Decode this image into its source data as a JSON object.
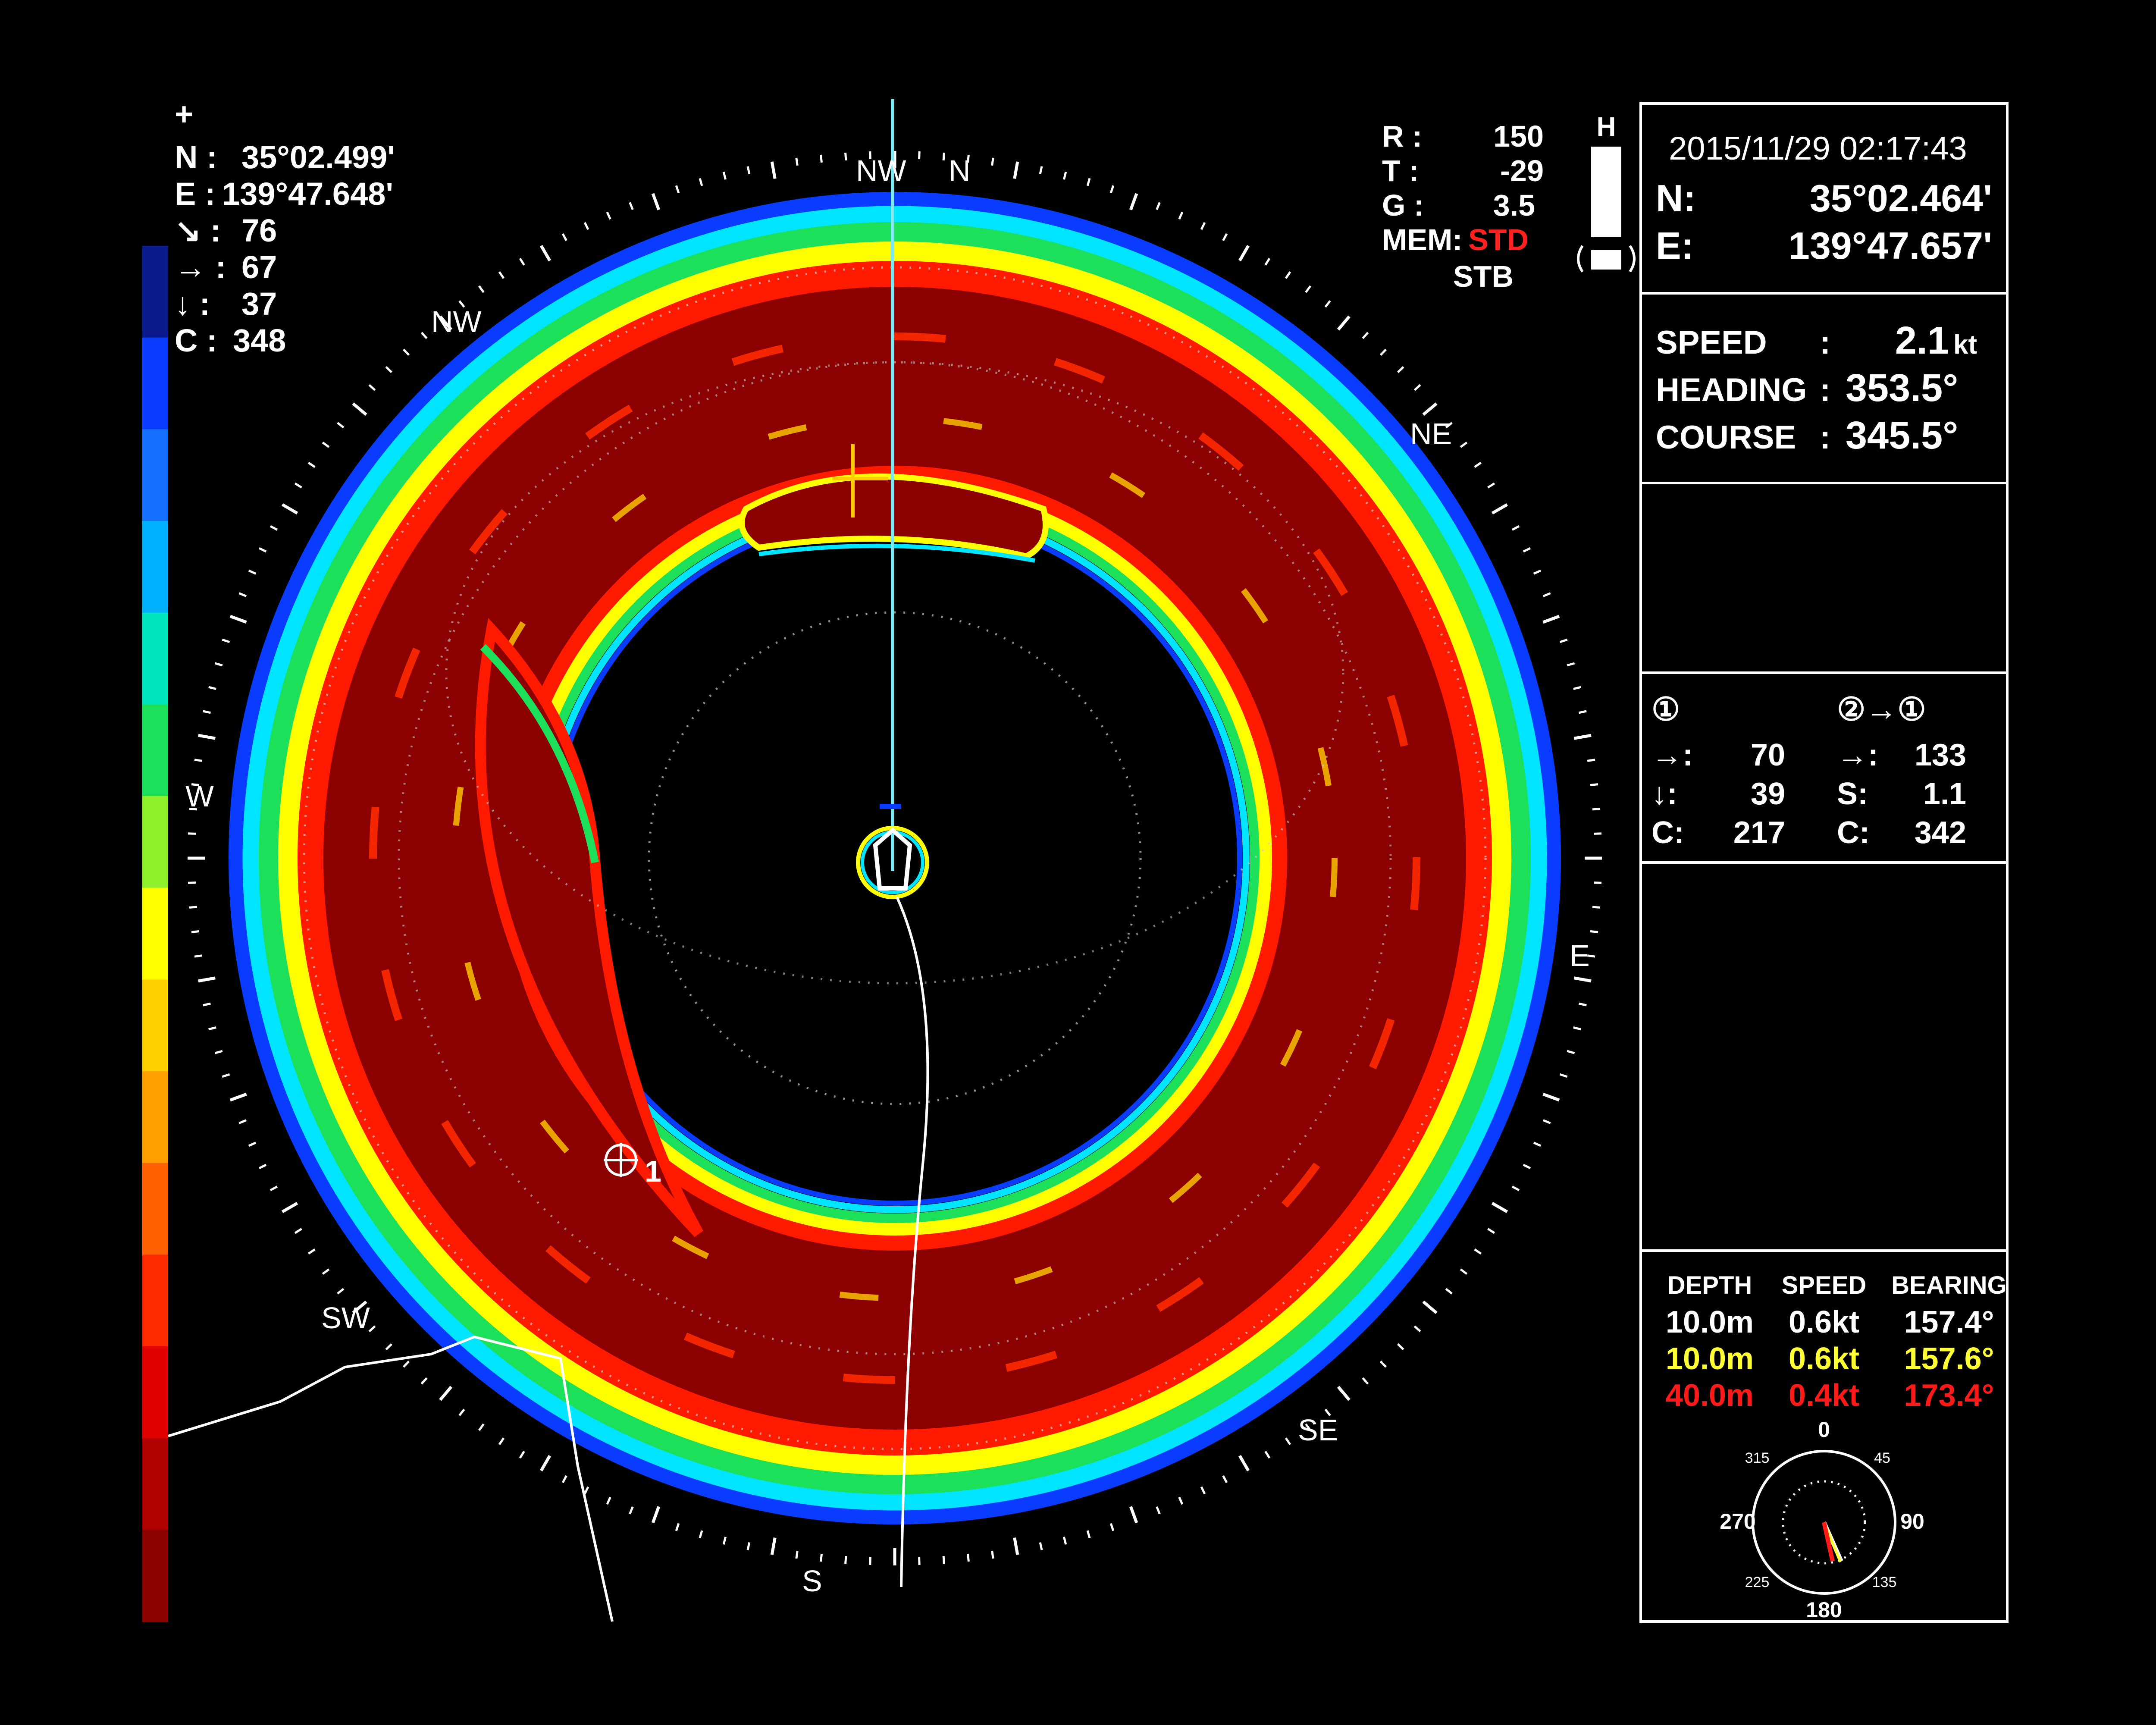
{
  "colors": {
    "background": "#000000",
    "echo_strong": "#8b0000",
    "echo_red": "#ff1a00",
    "echo_yellow": "#ffff00",
    "echo_green": "#1de05a",
    "echo_cyan": "#00e5ff",
    "echo_blue": "#0a3cff",
    "beam_line": "#7fe7f0",
    "track_line": "#ffffff",
    "layer_2": "#ffff33",
    "layer_3": "#ff1a1a",
    "memory_mode": "#ff2020"
  },
  "left_readout": {
    "cursor_mark": "+",
    "lat_label": "N :",
    "lat_value": "35°02.499'",
    "lon_label": "E :",
    "lon_value": "139°47.648'",
    "slant_label": "↘ :",
    "slant_value": "76",
    "horizontal_label": "→ :",
    "horizontal_value": "67",
    "depth_label": "↓ :",
    "depth_value": "37",
    "course_label": "C :",
    "course_value": "348"
  },
  "top_readout": {
    "range_label": "R :",
    "range_value": "150",
    "tilt_label": "T :",
    "tilt_value": "-29",
    "gain_label": "G :",
    "gain_value": "3.5",
    "mem_label": "MEM:",
    "mem_value": "STD",
    "mode_value": "STB",
    "hull_label": "H"
  },
  "radar": {
    "compass_labels": [
      "N",
      "NE",
      "E",
      "SE",
      "S",
      "SW",
      "W",
      "NW"
    ],
    "overlay_label": "NW",
    "target_marker": "1"
  },
  "info_panel": {
    "datetime": "2015/11/29 02:17:43",
    "lat_label": "N:",
    "lat_value": "35°02.464'",
    "lon_label": "E:",
    "lon_value": "139°47.657'",
    "speed_label": "SPEED",
    "speed_value": "2.1",
    "speed_unit": "kt",
    "heading_label": "HEADING",
    "heading_value": "353.5°",
    "course_label": "COURSE",
    "course_value": "345.5°",
    "colon": ":",
    "marker_a": "①",
    "marker_b": "②→①",
    "a_horizontal_label": "→:",
    "a_horizontal_value": "70",
    "a_depth_label": "↓:",
    "a_depth_value": "39",
    "a_course_label": "C:",
    "a_course_value": "217",
    "b_horizontal_label": "→:",
    "b_horizontal_value": "133",
    "b_speed_label": "S:",
    "b_speed_value": "1.1",
    "b_course_label": "C:",
    "b_course_value": "342",
    "current_headers": [
      "DEPTH",
      "SPEED",
      "BEARING"
    ],
    "current_rows": [
      {
        "depth": "10.0m",
        "speed": "0.6kt",
        "bearing": "157.4°"
      },
      {
        "depth": "10.0m",
        "speed": "0.6kt",
        "bearing": "157.6°"
      },
      {
        "depth": "40.0m",
        "speed": "0.4kt",
        "bearing": "173.4°"
      }
    ],
    "dial_labels": {
      "d0": "0",
      "d45": "45",
      "d90": "90",
      "d135": "135",
      "d180": "180",
      "d225": "225",
      "d270": "270",
      "d315": "315"
    }
  }
}
